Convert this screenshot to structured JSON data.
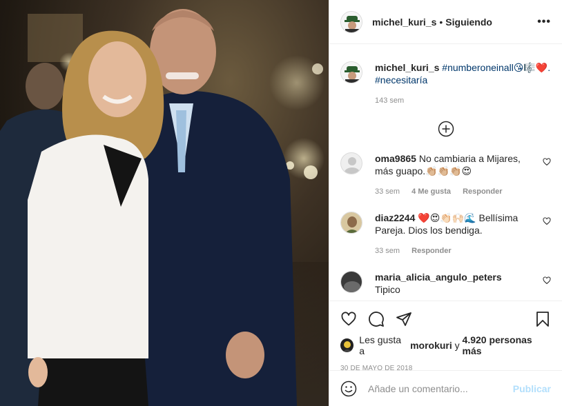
{
  "header": {
    "username": "michel_kuri_s",
    "separator": "•",
    "follow_status": "Siguiendo",
    "more_label": "•••"
  },
  "caption": {
    "username": "michel_kuri_s",
    "text": "#numberoneinall😘🎼❤️.",
    "hashtag2": "#necesitaría",
    "time": "143 sem"
  },
  "comments": [
    {
      "username": "oma9865",
      "text": "No cambiaria a Mijares, más guapo.👏🏼👏🏼👏🏼😍",
      "time": "33 sem",
      "likes": "4 Me gusta",
      "reply": "Responder"
    },
    {
      "username": "diaz2244",
      "text": "❤️😍👏🏻🙌🏻🌊 Bellísima Pareja. Dios los bendiga.",
      "time": "33 sem",
      "reply": "Responder"
    },
    {
      "username": "maria_alicia_angulo_peters",
      "text": "Tipico"
    }
  ],
  "likes": {
    "prefix": "Les gusta a",
    "user": "morokuri",
    "connector": "y",
    "count": "4.920 personas más"
  },
  "date": "30 DE MAYO DE 2018",
  "add_comment": {
    "placeholder": "Añade un comentario...",
    "publish": "Publicar"
  },
  "colors": {
    "link": "#00376b",
    "muted": "#8e8e8e",
    "publish_disabled": "#b2dffc"
  }
}
